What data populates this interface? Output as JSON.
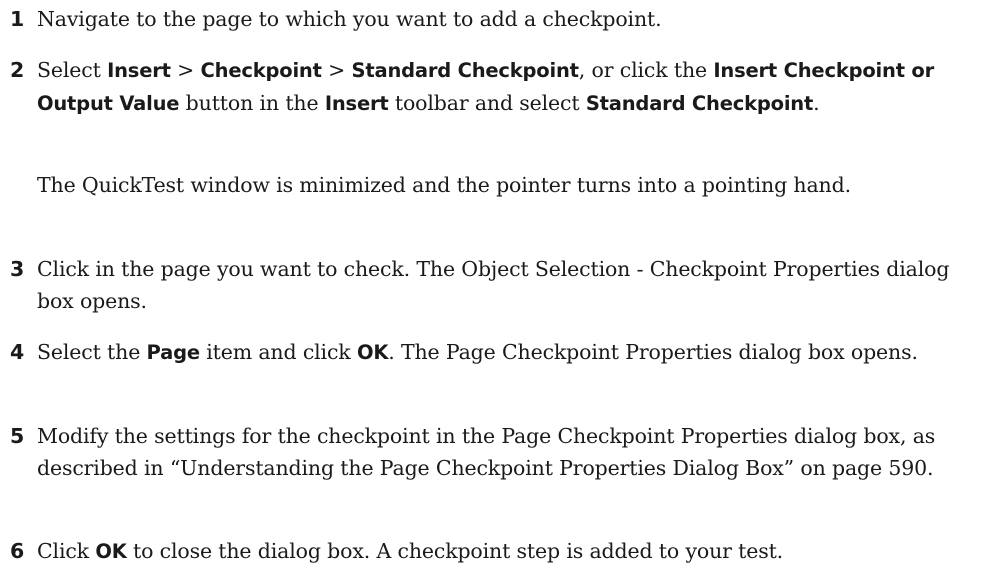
{
  "steps": [
    {
      "number": "1",
      "t1": "Navigate to the page to which you want to add a checkpoint."
    },
    {
      "number": "2",
      "t1": "Select ",
      "b1": "Insert",
      "t2": " > ",
      "b2": "Checkpoint",
      "t3": " > ",
      "b3": "Standard Checkpoint",
      "t4": ", or click the ",
      "b4": "Insert Checkpoint or Output Value",
      "t5": " button in the ",
      "b5": "Insert",
      "t6": " toolbar and select ",
      "b6": "Standard Checkpoint",
      "t7": ".",
      "note": "The QuickTest window is minimized and the pointer turns into a pointing hand."
    },
    {
      "number": "3",
      "t1": "Click in the page you want to check. The Object Selection - Checkpoint Properties dialog box opens."
    },
    {
      "number": "4",
      "t1": "Select the ",
      "b1": "Page",
      "t2": " item and click ",
      "b2": "OK",
      "t3": ". The Page Checkpoint Properties dialog box opens."
    },
    {
      "number": "5",
      "t1": "Modify the settings for the checkpoint in the Page Checkpoint Properties dialog box, as described in “Understanding the Page Checkpoint Properties Dialog Box” on page 590."
    },
    {
      "number": "6",
      "t1": "Click ",
      "b1": "OK",
      "t2": " to close the dialog box. A checkpoint step is added to your test."
    }
  ]
}
